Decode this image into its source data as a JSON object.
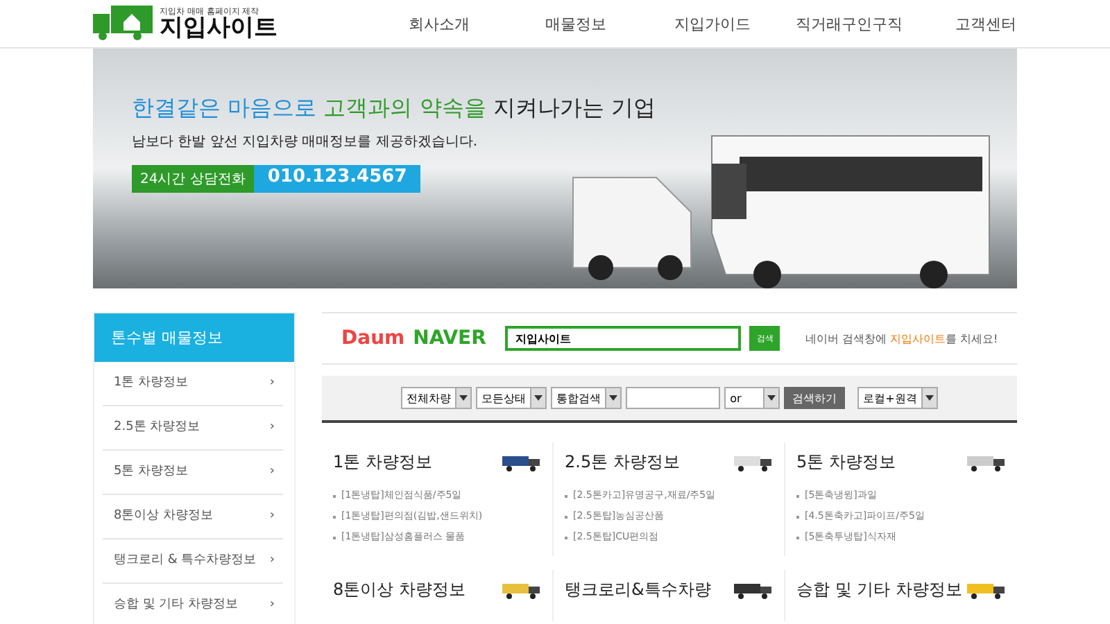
{
  "logo": {
    "tagline": "지입차 매매 홈페이지 제작",
    "name": "지입사이트"
  },
  "nav": [
    "회사소개",
    "매물정보",
    "지입가이드",
    "직거래구인구직",
    "고객센터"
  ],
  "banner": {
    "headline": {
      "part1": "한결같은 마음으로",
      "part2": "고객과의 약속을",
      "part3": "지켜나가는 기업"
    },
    "subline": "남보다 한발 앞선 지입차량 매매정보를 제공하겠습니다.",
    "phone_label": "24시간 상담전화",
    "phone": "010.123.4567"
  },
  "sidebar": {
    "title": "톤수별 매물정보",
    "items": [
      {
        "label": "1톤 차량정보",
        "arrow": "›"
      },
      {
        "label": "2.5톤 차량정보",
        "arrow": "›"
      },
      {
        "label": "5톤 차량정보",
        "arrow": "›"
      },
      {
        "label": "8톤이상 차량정보",
        "arrow": "›"
      },
      {
        "label": "탱크로리 & 특수차량정보",
        "arrow": "›"
      },
      {
        "label": "승합 및 기타 차량정보",
        "arrow": "›"
      }
    ]
  },
  "portal_search": {
    "daum": "Daum",
    "naver": "NAVER",
    "query": "지입사이트",
    "button": "검색",
    "hint_before": "네이버 검색창에 ",
    "hint_keyword": "지입사이트",
    "hint_after": "를 치세요!"
  },
  "filter": {
    "vehicle": "전체차량",
    "status": "모든상태",
    "scope": "통합검색",
    "operator": "or",
    "button": "검색하기",
    "sort": "로컬+원격"
  },
  "categories": [
    {
      "title": "1톤 차량정보",
      "items": [
        "[1톤냉탑]체인점식품/주5일",
        "[1톤냉탑]편의점(김밥,샌드위치)",
        "[1톤냉탑]삼성홈플러스 물품"
      ]
    },
    {
      "title": "2.5톤 차량정보",
      "items": [
        "[2.5톤카고]유명공구,재료/주5일",
        "[2.5톤탑]농심공산품",
        "[2.5톤탑]CU편의점"
      ]
    },
    {
      "title": "5톤 차량정보",
      "items": [
        "[5톤축냉윙]과일",
        "[4.5톤축카고]파이프/주5일",
        "[5톤축투냉탑]식자재"
      ]
    },
    {
      "title": "8톤이상 차량정보"
    },
    {
      "title": "탱크로리&특수차량"
    },
    {
      "title": "승합 및 기타 차량정보"
    }
  ]
}
